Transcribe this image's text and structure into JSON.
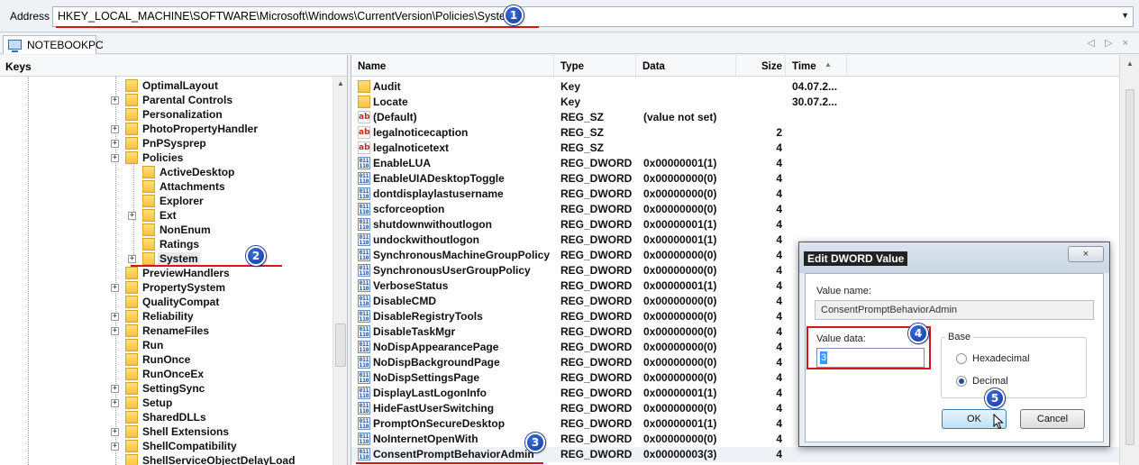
{
  "address_bar": {
    "label": "Address",
    "path": "HKEY_LOCAL_MACHINE\\SOFTWARE\\Microsoft\\Windows\\CurrentVersion\\Policies\\System",
    "dropdown_icon": "chevron-down-icon"
  },
  "tab": {
    "label": "NOTEBOOKPC",
    "nav_icons": "◁ ▷ ×"
  },
  "tree": {
    "header": "Keys",
    "nodes": [
      {
        "label": "OptimalLayout",
        "level": 0,
        "expander": false
      },
      {
        "label": "Parental Controls",
        "level": 0,
        "expander": true
      },
      {
        "label": "Personalization",
        "level": 0,
        "expander": false
      },
      {
        "label": "PhotoPropertyHandler",
        "level": 0,
        "expander": true
      },
      {
        "label": "PnPSysprep",
        "level": 0,
        "expander": true
      },
      {
        "label": "Policies",
        "level": 0,
        "expander": true
      },
      {
        "label": "ActiveDesktop",
        "level": 1,
        "expander": false
      },
      {
        "label": "Attachments",
        "level": 1,
        "expander": false
      },
      {
        "label": "Explorer",
        "level": 1,
        "expander": false
      },
      {
        "label": "Ext",
        "level": 1,
        "expander": true
      },
      {
        "label": "NonEnum",
        "level": 1,
        "expander": false
      },
      {
        "label": "Ratings",
        "level": 1,
        "expander": false
      },
      {
        "label": "System",
        "level": 1,
        "expander": true,
        "selected": true
      },
      {
        "label": "PreviewHandlers",
        "level": 0,
        "expander": false
      },
      {
        "label": "PropertySystem",
        "level": 0,
        "expander": true
      },
      {
        "label": "QualityCompat",
        "level": 0,
        "expander": false
      },
      {
        "label": "Reliability",
        "level": 0,
        "expander": true
      },
      {
        "label": "RenameFiles",
        "level": 0,
        "expander": true
      },
      {
        "label": "Run",
        "level": 0,
        "expander": false
      },
      {
        "label": "RunOnce",
        "level": 0,
        "expander": false
      },
      {
        "label": "RunOnceEx",
        "level": 0,
        "expander": false
      },
      {
        "label": "SettingSync",
        "level": 0,
        "expander": true
      },
      {
        "label": "Setup",
        "level": 0,
        "expander": true
      },
      {
        "label": "SharedDLLs",
        "level": 0,
        "expander": false
      },
      {
        "label": "Shell Extensions",
        "level": 0,
        "expander": true
      },
      {
        "label": "ShellCompatibility",
        "level": 0,
        "expander": true
      },
      {
        "label": "ShellServiceObjectDelayLoad",
        "level": 0,
        "expander": false
      }
    ]
  },
  "values_table": {
    "columns": [
      "Name",
      "Type",
      "Data",
      "Size",
      "Time"
    ],
    "rows": [
      {
        "icon": "folder",
        "name": "Audit",
        "type": "Key",
        "data": "",
        "size": "",
        "time": "04.07.2..."
      },
      {
        "icon": "folder",
        "name": "Locate",
        "type": "Key",
        "data": "",
        "size": "",
        "time": "30.07.2..."
      },
      {
        "icon": "string",
        "name": "(Default)",
        "type": "REG_SZ",
        "data": "(value not set)",
        "size": "",
        "time": ""
      },
      {
        "icon": "string",
        "name": "legalnoticecaption",
        "type": "REG_SZ",
        "data": "",
        "size": "2",
        "time": ""
      },
      {
        "icon": "string",
        "name": "legalnoticetext",
        "type": "REG_SZ",
        "data": "",
        "size": "4",
        "time": ""
      },
      {
        "icon": "binary",
        "name": "EnableLUA",
        "type": "REG_DWORD",
        "data": "0x00000001(1)",
        "size": "4",
        "time": ""
      },
      {
        "icon": "binary",
        "name": "EnableUIADesktopToggle",
        "type": "REG_DWORD",
        "data": "0x00000000(0)",
        "size": "4",
        "time": ""
      },
      {
        "icon": "binary",
        "name": "dontdisplaylastusername",
        "type": "REG_DWORD",
        "data": "0x00000000(0)",
        "size": "4",
        "time": ""
      },
      {
        "icon": "binary",
        "name": "scforceoption",
        "type": "REG_DWORD",
        "data": "0x00000000(0)",
        "size": "4",
        "time": ""
      },
      {
        "icon": "binary",
        "name": "shutdownwithoutlogon",
        "type": "REG_DWORD",
        "data": "0x00000001(1)",
        "size": "4",
        "time": ""
      },
      {
        "icon": "binary",
        "name": "undockwithoutlogon",
        "type": "REG_DWORD",
        "data": "0x00000001(1)",
        "size": "4",
        "time": ""
      },
      {
        "icon": "binary",
        "name": "SynchronousMachineGroupPolicy",
        "type": "REG_DWORD",
        "data": "0x00000000(0)",
        "size": "4",
        "time": ""
      },
      {
        "icon": "binary",
        "name": "SynchronousUserGroupPolicy",
        "type": "REG_DWORD",
        "data": "0x00000000(0)",
        "size": "4",
        "time": ""
      },
      {
        "icon": "binary",
        "name": "VerboseStatus",
        "type": "REG_DWORD",
        "data": "0x00000001(1)",
        "size": "4",
        "time": ""
      },
      {
        "icon": "binary",
        "name": "DisableCMD",
        "type": "REG_DWORD",
        "data": "0x00000000(0)",
        "size": "4",
        "time": ""
      },
      {
        "icon": "binary",
        "name": "DisableRegistryTools",
        "type": "REG_DWORD",
        "data": "0x00000000(0)",
        "size": "4",
        "time": ""
      },
      {
        "icon": "binary",
        "name": "DisableTaskMgr",
        "type": "REG_DWORD",
        "data": "0x00000000(0)",
        "size": "4",
        "time": ""
      },
      {
        "icon": "binary",
        "name": "NoDispAppearancePage",
        "type": "REG_DWORD",
        "data": "0x00000000(0)",
        "size": "4",
        "time": ""
      },
      {
        "icon": "binary",
        "name": "NoDispBackgroundPage",
        "type": "REG_DWORD",
        "data": "0x00000000(0)",
        "size": "4",
        "time": ""
      },
      {
        "icon": "binary",
        "name": "NoDispSettingsPage",
        "type": "REG_DWORD",
        "data": "0x00000000(0)",
        "size": "4",
        "time": ""
      },
      {
        "icon": "binary",
        "name": "DisplayLastLogonInfo",
        "type": "REG_DWORD",
        "data": "0x00000001(1)",
        "size": "4",
        "time": ""
      },
      {
        "icon": "binary",
        "name": "HideFastUserSwitching",
        "type": "REG_DWORD",
        "data": "0x00000000(0)",
        "size": "4",
        "time": ""
      },
      {
        "icon": "binary",
        "name": "PromptOnSecureDesktop",
        "type": "REG_DWORD",
        "data": "0x00000001(1)",
        "size": "4",
        "time": ""
      },
      {
        "icon": "binary",
        "name": "NoInternetOpenWith",
        "type": "REG_DWORD",
        "data": "0x00000000(0)",
        "size": "4",
        "time": ""
      },
      {
        "icon": "binary",
        "name": "ConsentPromptBehaviorAdmin",
        "type": "REG_DWORD",
        "data": "0x00000003(3)",
        "size": "4",
        "time": "",
        "highlighted": true
      }
    ]
  },
  "dialog": {
    "title": "Edit DWORD Value",
    "close_label": "×",
    "value_name_label": "Value name:",
    "value_name": "ConsentPromptBehaviorAdmin",
    "value_data_label": "Value data:",
    "value_data": "3",
    "base_label": "Base",
    "hex_label": "Hexadecimal",
    "dec_label": "Decimal",
    "ok_label": "OK",
    "cancel_label": "Cancel"
  },
  "annotations": {
    "badges": [
      "1",
      "2",
      "3",
      "4",
      "5"
    ],
    "highlight_color": "#d8141b",
    "badge_color": "#1d47b8"
  }
}
